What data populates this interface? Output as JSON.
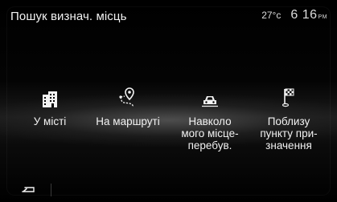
{
  "header": {
    "title": "Пошук визнач. місць",
    "temperature": "27°c",
    "time": "6 16",
    "ampm": "PM"
  },
  "options": [
    {
      "label": "У місті",
      "icon": "city-buildings-icon"
    },
    {
      "label": "На маршруті",
      "icon": "route-pin-icon"
    },
    {
      "label": "Навколо\nмого місце-\nперебув.",
      "icon": "car-location-icon"
    },
    {
      "label": "Поблизу\nпункту при-\nзначення",
      "icon": "destination-flag-icon"
    }
  ],
  "footer": {
    "back_icon": "back-arrow-icon"
  },
  "colors": {
    "background": "#000000",
    "text": "#f2f2f2"
  }
}
